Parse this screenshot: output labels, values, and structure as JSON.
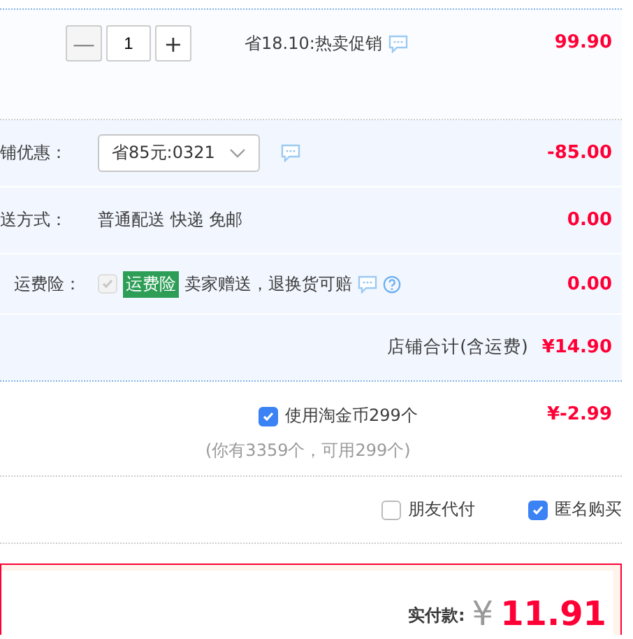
{
  "item": {
    "quantity": "1",
    "minus": "—",
    "plus": "+",
    "minus_disabled": true,
    "promo": "省18.10:热卖促销",
    "price": "99.90"
  },
  "shop_discount": {
    "label": "铺优惠：",
    "value": "省85元:0321",
    "amount": "-85.00"
  },
  "shipping": {
    "label": "送方式：",
    "value": "普通配送 快递 免邮",
    "amount": "0.00"
  },
  "insurance": {
    "label": "运费险：",
    "checked": true,
    "disabled": true,
    "badge": "运费险",
    "text": "卖家赠送，退换货可赔",
    "amount": "0.00"
  },
  "shop_total": {
    "label": "店铺合计(含运费)",
    "amount": "¥14.90"
  },
  "coins": {
    "label": "使用淘金币299个",
    "checked": true,
    "hint": "(你有3359个，可用299个)",
    "amount": "¥-2.99"
  },
  "options": [
    {
      "label": "朋友代付",
      "checked": false
    },
    {
      "label": "匿名购买",
      "checked": true
    }
  ],
  "payment": {
    "label": "实付款:",
    "currency": "¥",
    "amount": "11.91"
  }
}
